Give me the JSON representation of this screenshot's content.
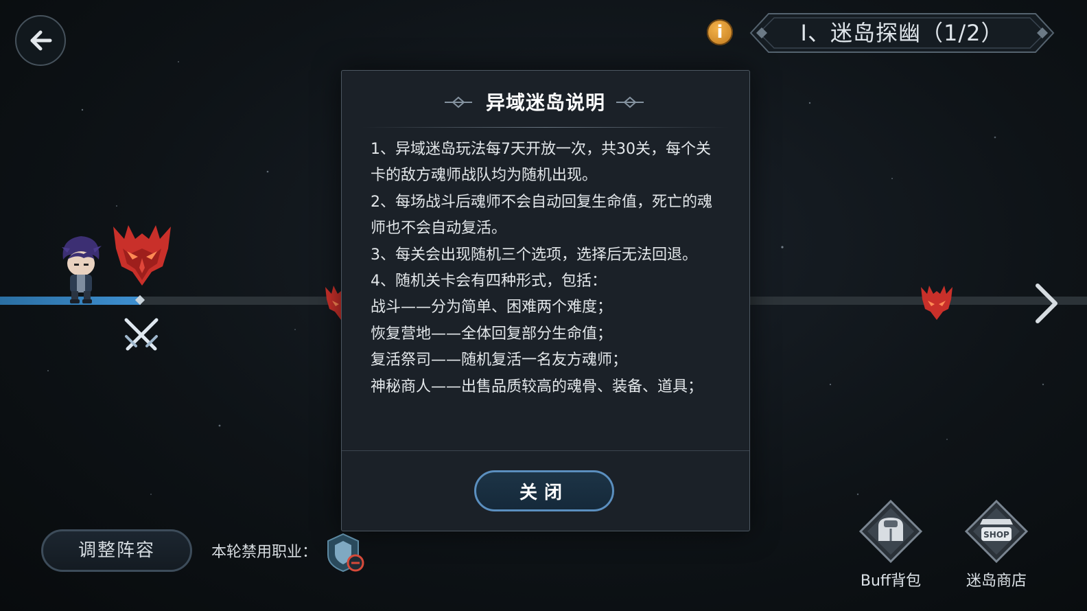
{
  "header": {
    "back_icon": "back-arrow-icon",
    "info_label": "i",
    "stage_title": "Ⅰ、迷岛探幽（1/2）"
  },
  "map": {
    "next_icon": "chevron-right-icon"
  },
  "modal": {
    "title": "异域迷岛说明",
    "lines": [
      "1、异域迷岛玩法每7天开放一次，共30关，每个关卡的敌方魂师战队均为随机出现。",
      "2、每场战斗后魂师不会自动回复生命值，死亡的魂师也不会自动复活。",
      "3、每关会出现随机三个选项，选择后无法回退。",
      "4、随机关卡会有四种形式，包括：",
      "战斗——分为简单、困难两个难度；",
      "恢复营地——全体回复部分生命值；",
      "复活祭司——随机复活一名友方魂师；",
      "神秘商人——出售品质较高的魂骨、装备、道具；"
    ],
    "close_label": "关闭"
  },
  "footer": {
    "formation_label": "调整阵容",
    "banned_label": "本轮禁用职业：",
    "buff_bag_label": "Buff背包",
    "shop_label": "迷岛商店",
    "shop_sign": "SHOP"
  },
  "colors": {
    "accent_blue": "#3e8fd0",
    "enemy_red": "#c9302a",
    "info_orange": "#e09a35"
  }
}
